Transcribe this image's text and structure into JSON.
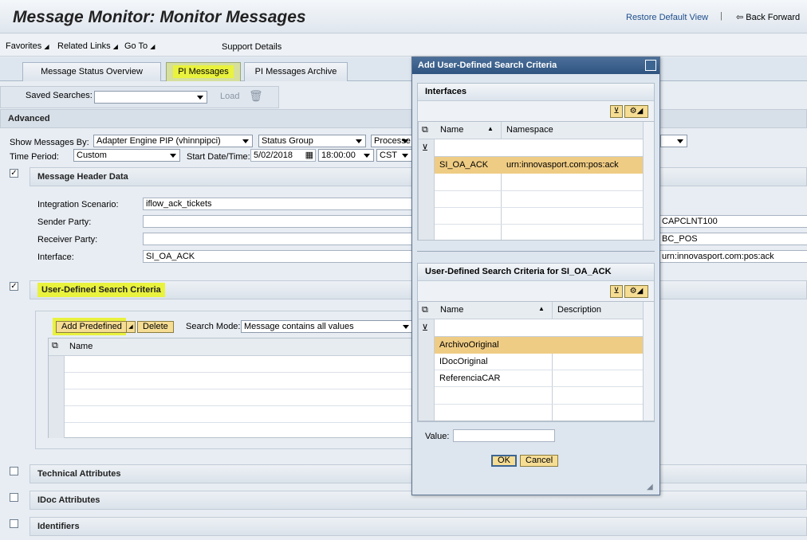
{
  "header": {
    "title": "Message Monitor: Monitor Messages",
    "restore_default": "Restore Default View",
    "back_forward": "Back Forward"
  },
  "menu": {
    "favorites": "Favorites",
    "related_links": "Related Links",
    "go_to": "Go To",
    "support_details": "Support Details"
  },
  "tabs": [
    {
      "label": "Message Status Overview"
    },
    {
      "label": "PI Messages"
    },
    {
      "label": "PI Messages Archive"
    }
  ],
  "toolbar": {
    "saved_searches": "Saved Searches:",
    "load": "Load"
  },
  "advanced": {
    "title": "Advanced",
    "show_messages_by_label": "Show Messages By:",
    "show_messages_by_value": "Adapter Engine PIP (vhinnpipci)",
    "status_group": "Status Group",
    "processed": "Processe",
    "time_period_label": "Time Period:",
    "time_period_value": "Custom",
    "start_label": "Start Date/Time:",
    "start_date": "5/02/2018",
    "start_time": "18:00:00",
    "timezone": "CST"
  },
  "header_data": {
    "title": "Message Header Data",
    "integration_scenario_label": "Integration Scenario:",
    "integration_scenario_value": "iflow_ack_tickets",
    "sender_party_label": "Sender Party:",
    "receiver_party_label": "Receiver Party:",
    "interface_label": "Interface:",
    "interface_value": "SI_OA_ACK",
    "right_sender": "CAPCLNT100",
    "right_receiver": "BC_POS",
    "right_interface": "urn:innovasport.com:pos:ack"
  },
  "udsc": {
    "title": "User-Defined Search Criteria",
    "add_predefined": "Add Predefined",
    "delete": "Delete",
    "search_mode_label": "Search Mode:",
    "search_mode_value": "Message contains all values",
    "name_col": "Name"
  },
  "sections": {
    "technical": "Technical Attributes",
    "idoc": "IDoc Attributes",
    "identifiers": "Identifiers"
  },
  "dialog": {
    "title": "Add User-Defined Search Criteria",
    "interfaces_title": "Interfaces",
    "iface_cols": {
      "name": "Name",
      "namespace": "Namespace"
    },
    "iface_rows": [
      {
        "name": "SI_OA_ACK",
        "namespace": "urn:innovasport.com:pos:ack"
      }
    ],
    "criteria_title": "User-Defined Search Criteria for  SI_OA_ACK",
    "crit_cols": {
      "name": "Name",
      "description": "Description"
    },
    "crit_rows": [
      {
        "name": "ArchivoOriginal"
      },
      {
        "name": "IDocOriginal"
      },
      {
        "name": "ReferenciaCAR"
      }
    ],
    "value_label": "Value:",
    "ok": "OK",
    "cancel": "Cancel"
  }
}
